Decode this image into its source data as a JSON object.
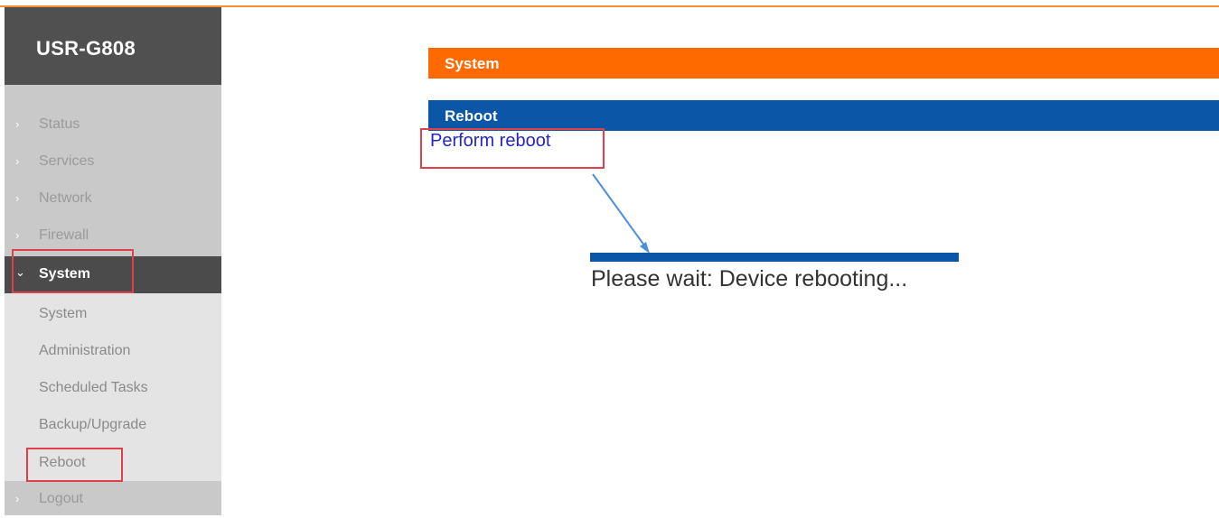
{
  "sidebar": {
    "logo": "USR-G808",
    "items": [
      {
        "label": "Status"
      },
      {
        "label": "Services"
      },
      {
        "label": "Network"
      },
      {
        "label": "Firewall"
      },
      {
        "label": "System"
      }
    ],
    "sub_items": [
      {
        "label": "System"
      },
      {
        "label": "Administration"
      },
      {
        "label": "Scheduled Tasks"
      },
      {
        "label": "Backup/Upgrade"
      },
      {
        "label": "Reboot"
      }
    ],
    "logout": "Logout"
  },
  "main": {
    "section_title": "System",
    "panel_title": "Reboot",
    "perform_link": "Perform reboot",
    "wait_message": "Please wait: Device rebooting..."
  },
  "colors": {
    "orange": "#ff6a00",
    "blue": "#0b56a6",
    "highlight": "#e0404a",
    "link": "#2424c8"
  }
}
